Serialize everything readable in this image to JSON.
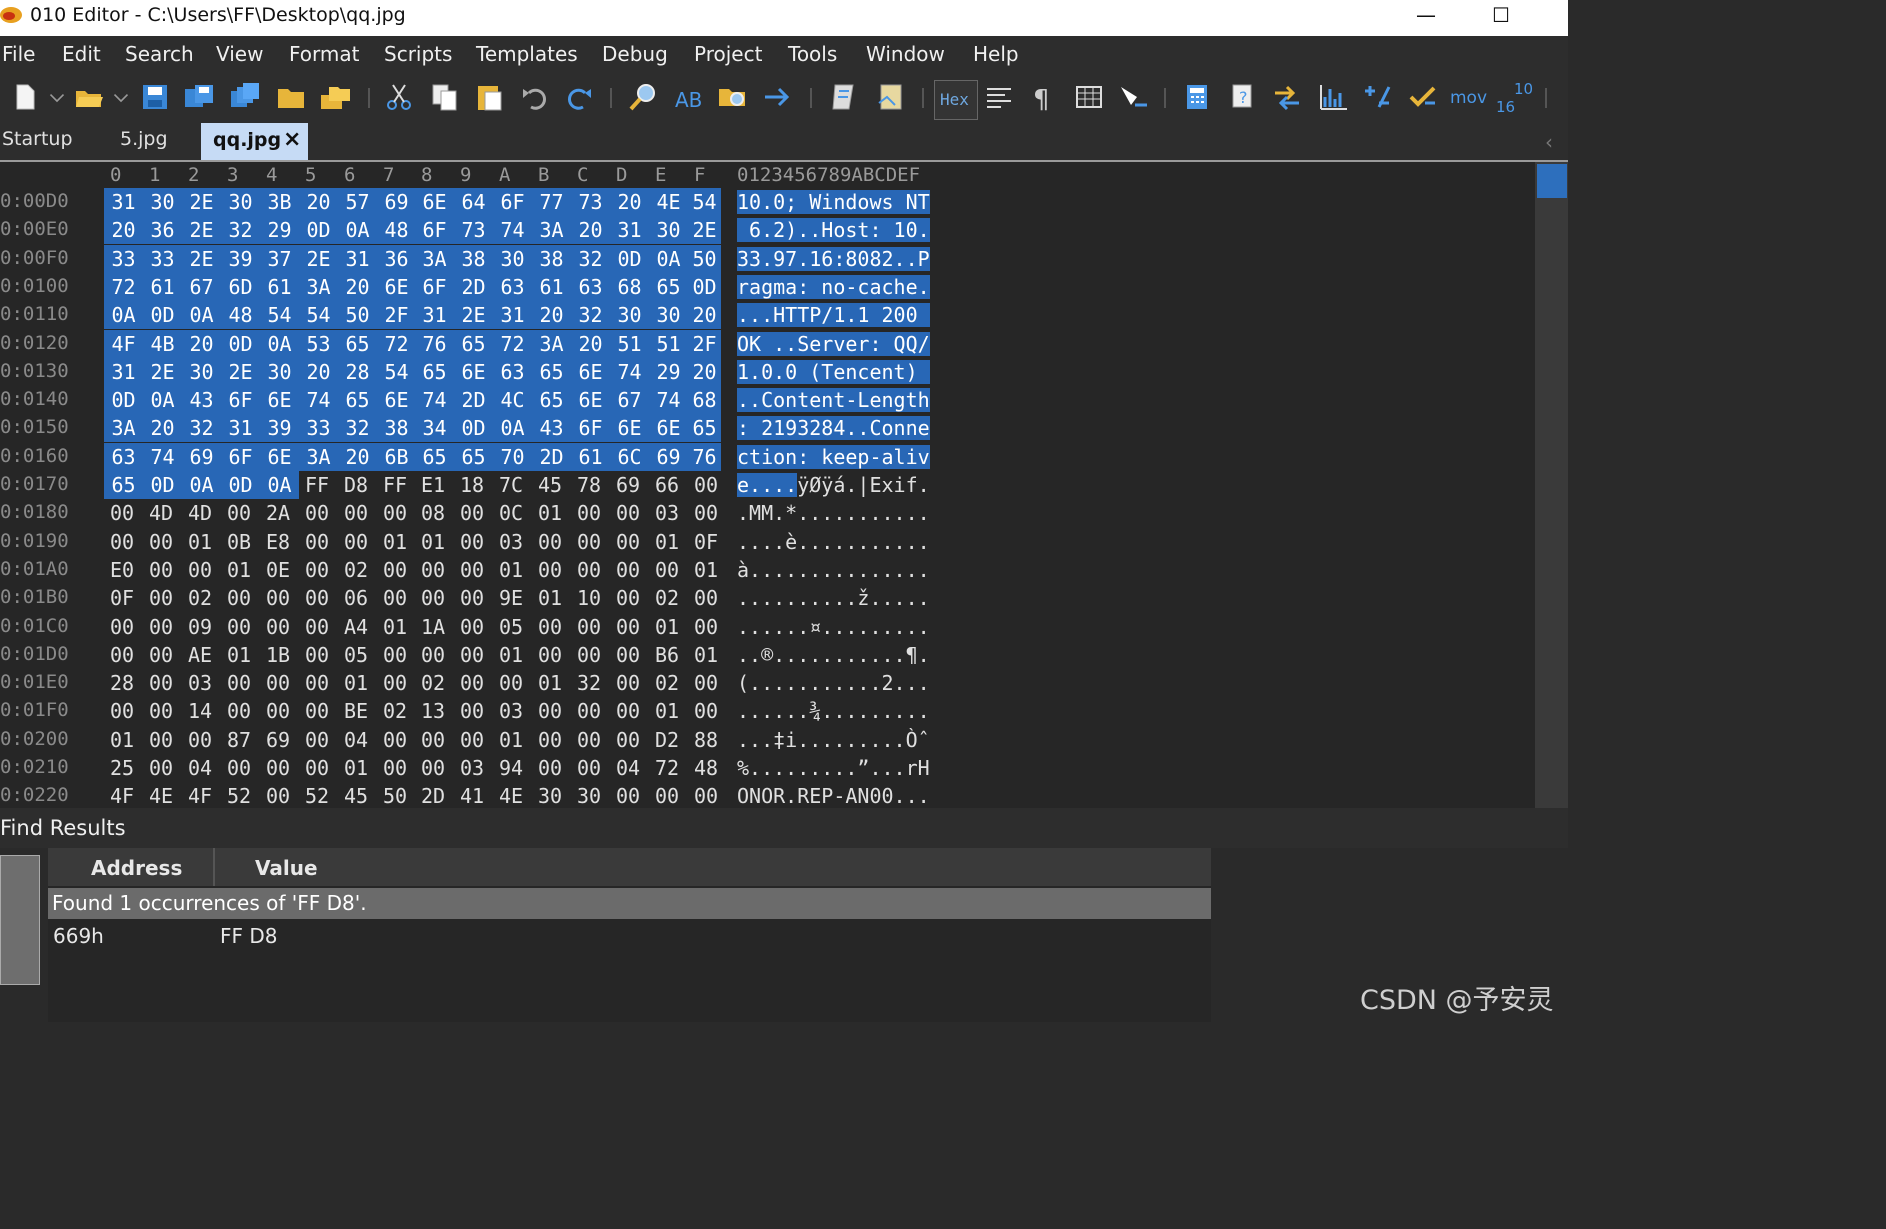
{
  "window": {
    "title": "010 Editor - C:\\Users\\FF\\Desktop\\qq.jpg",
    "minimize": "—",
    "maximize": "☐"
  },
  "menu": [
    "File",
    "Edit",
    "Search",
    "View",
    "Format",
    "Scripts",
    "Templates",
    "Debug",
    "Project",
    "Tools",
    "Window",
    "Help"
  ],
  "toolbar": {
    "hex_label": "Hex",
    "mov_label": "mov",
    "base_top": "10",
    "base_bottom": "16"
  },
  "tabs": {
    "startup": "Startup",
    "file1": "5.jpg",
    "active": "qq.jpg",
    "close": "×"
  },
  "hex": {
    "column_header": [
      "0",
      "1",
      "2",
      "3",
      "4",
      "5",
      "6",
      "7",
      "8",
      "9",
      "A",
      "B",
      "C",
      "D",
      "E",
      "F"
    ],
    "ascii_header": "0123456789ABCDEF",
    "selection_color": "#2867b6",
    "rows": [
      {
        "addr": "0:00D0",
        "bytes": [
          "31",
          "30",
          "2E",
          "30",
          "3B",
          "20",
          "57",
          "69",
          "6E",
          "64",
          "6F",
          "77",
          "73",
          "20",
          "4E",
          "54"
        ],
        "ascii": "10.0; Windows NT",
        "sel": 16
      },
      {
        "addr": "0:00E0",
        "bytes": [
          "20",
          "36",
          "2E",
          "32",
          "29",
          "0D",
          "0A",
          "48",
          "6F",
          "73",
          "74",
          "3A",
          "20",
          "31",
          "30",
          "2E"
        ],
        "ascii": " 6.2)..Host: 10.",
        "sel": 16
      },
      {
        "addr": "0:00F0",
        "bytes": [
          "33",
          "33",
          "2E",
          "39",
          "37",
          "2E",
          "31",
          "36",
          "3A",
          "38",
          "30",
          "38",
          "32",
          "0D",
          "0A",
          "50"
        ],
        "ascii": "33.97.16:8082..P",
        "sel": 16
      },
      {
        "addr": "0:0100",
        "bytes": [
          "72",
          "61",
          "67",
          "6D",
          "61",
          "3A",
          "20",
          "6E",
          "6F",
          "2D",
          "63",
          "61",
          "63",
          "68",
          "65",
          "0D"
        ],
        "ascii": "ragma: no-cache.",
        "sel": 16
      },
      {
        "addr": "0:0110",
        "bytes": [
          "0A",
          "0D",
          "0A",
          "48",
          "54",
          "54",
          "50",
          "2F",
          "31",
          "2E",
          "31",
          "20",
          "32",
          "30",
          "30",
          "20"
        ],
        "ascii": "...HTTP/1.1 200 ",
        "sel": 16
      },
      {
        "addr": "0:0120",
        "bytes": [
          "4F",
          "4B",
          "20",
          "0D",
          "0A",
          "53",
          "65",
          "72",
          "76",
          "65",
          "72",
          "3A",
          "20",
          "51",
          "51",
          "2F"
        ],
        "ascii": "OK ..Server: QQ/",
        "sel": 16
      },
      {
        "addr": "0:0130",
        "bytes": [
          "31",
          "2E",
          "30",
          "2E",
          "30",
          "20",
          "28",
          "54",
          "65",
          "6E",
          "63",
          "65",
          "6E",
          "74",
          "29",
          "20"
        ],
        "ascii": "1.0.0 (Tencent) ",
        "sel": 16
      },
      {
        "addr": "0:0140",
        "bytes": [
          "0D",
          "0A",
          "43",
          "6F",
          "6E",
          "74",
          "65",
          "6E",
          "74",
          "2D",
          "4C",
          "65",
          "6E",
          "67",
          "74",
          "68"
        ],
        "ascii": "..Content-Length",
        "sel": 16
      },
      {
        "addr": "0:0150",
        "bytes": [
          "3A",
          "20",
          "32",
          "31",
          "39",
          "33",
          "32",
          "38",
          "34",
          "0D",
          "0A",
          "43",
          "6F",
          "6E",
          "6E",
          "65"
        ],
        "ascii": ": 2193284..Conne",
        "sel": 16
      },
      {
        "addr": "0:0160",
        "bytes": [
          "63",
          "74",
          "69",
          "6F",
          "6E",
          "3A",
          "20",
          "6B",
          "65",
          "65",
          "70",
          "2D",
          "61",
          "6C",
          "69",
          "76"
        ],
        "ascii": "ction: keep-aliv",
        "sel": 16
      },
      {
        "addr": "0:0170",
        "bytes": [
          "65",
          "0D",
          "0A",
          "0D",
          "0A",
          "FF",
          "D8",
          "FF",
          "E1",
          "18",
          "7C",
          "45",
          "78",
          "69",
          "66",
          "00"
        ],
        "ascii": "e....ÿØÿá.|Exif.",
        "sel": 5
      },
      {
        "addr": "0:0180",
        "bytes": [
          "00",
          "4D",
          "4D",
          "00",
          "2A",
          "00",
          "00",
          "00",
          "08",
          "00",
          "0C",
          "01",
          "00",
          "00",
          "03",
          "00"
        ],
        "ascii": ".MM.*...........",
        "sel": 0
      },
      {
        "addr": "0:0190",
        "bytes": [
          "00",
          "00",
          "01",
          "0B",
          "E8",
          "00",
          "00",
          "01",
          "01",
          "00",
          "03",
          "00",
          "00",
          "00",
          "01",
          "0F"
        ],
        "ascii": "....è...........",
        "sel": 0
      },
      {
        "addr": "0:01A0",
        "bytes": [
          "E0",
          "00",
          "00",
          "01",
          "0E",
          "00",
          "02",
          "00",
          "00",
          "00",
          "01",
          "00",
          "00",
          "00",
          "00",
          "01"
        ],
        "ascii": "à...............",
        "sel": 0
      },
      {
        "addr": "0:01B0",
        "bytes": [
          "0F",
          "00",
          "02",
          "00",
          "00",
          "00",
          "06",
          "00",
          "00",
          "00",
          "9E",
          "01",
          "10",
          "00",
          "02",
          "00"
        ],
        "ascii": "..........ž.....",
        "sel": 0
      },
      {
        "addr": "0:01C0",
        "bytes": [
          "00",
          "00",
          "09",
          "00",
          "00",
          "00",
          "A4",
          "01",
          "1A",
          "00",
          "05",
          "00",
          "00",
          "00",
          "01",
          "00"
        ],
        "ascii": "......¤.........",
        "sel": 0
      },
      {
        "addr": "0:01D0",
        "bytes": [
          "00",
          "00",
          "AE",
          "01",
          "1B",
          "00",
          "05",
          "00",
          "00",
          "00",
          "01",
          "00",
          "00",
          "00",
          "B6",
          "01"
        ],
        "ascii": "..®...........¶.",
        "sel": 0
      },
      {
        "addr": "0:01E0",
        "bytes": [
          "28",
          "00",
          "03",
          "00",
          "00",
          "00",
          "01",
          "00",
          "02",
          "00",
          "00",
          "01",
          "32",
          "00",
          "02",
          "00"
        ],
        "ascii": "(...........2...",
        "sel": 0
      },
      {
        "addr": "0:01F0",
        "bytes": [
          "00",
          "00",
          "14",
          "00",
          "00",
          "00",
          "BE",
          "02",
          "13",
          "00",
          "03",
          "00",
          "00",
          "00",
          "01",
          "00"
        ],
        "ascii": "......¾.........",
        "sel": 0
      },
      {
        "addr": "0:0200",
        "bytes": [
          "01",
          "00",
          "00",
          "87",
          "69",
          "00",
          "04",
          "00",
          "00",
          "00",
          "01",
          "00",
          "00",
          "00",
          "D2",
          "88"
        ],
        "ascii": "...‡i.........Òˆ",
        "sel": 0
      },
      {
        "addr": "0:0210",
        "bytes": [
          "25",
          "00",
          "04",
          "00",
          "00",
          "00",
          "01",
          "00",
          "00",
          "03",
          "94",
          "00",
          "00",
          "04",
          "72",
          "48"
        ],
        "ascii": "%.........”...rH",
        "sel": 0
      },
      {
        "addr": "0:0220",
        "bytes": [
          "4F",
          "4E",
          "4F",
          "52",
          "00",
          "52",
          "45",
          "50",
          "2D",
          "41",
          "4E",
          "30",
          "30",
          "00",
          "00",
          "00"
        ],
        "ascii": "ONOR.REP-AN00...",
        "sel": 0
      }
    ]
  },
  "find": {
    "panel_title": "Find Results",
    "col_address": "Address",
    "col_value": "Value",
    "summary": "Found 1 occurrences of 'FF D8'.",
    "results": [
      {
        "address": "669h",
        "value": "FF D8"
      }
    ]
  },
  "watermark": "CSDN @予安灵"
}
